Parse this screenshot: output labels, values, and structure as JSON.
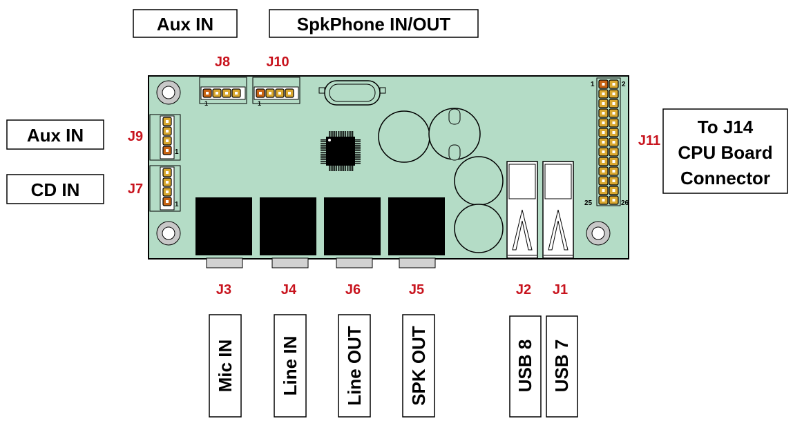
{
  "colors": {
    "board": "#b4dcc6",
    "outline": "#000000",
    "jack": "#000000",
    "connector_label": "#c8141e",
    "pin_gold": "#d9a830",
    "pin_first": "#c86414",
    "mount_hole_ring": "#c8c8c8"
  },
  "top_boxes": [
    {
      "text": "Aux IN"
    },
    {
      "text": "SpkPhone IN/OUT"
    }
  ],
  "left_boxes": [
    {
      "text": "Aux IN"
    },
    {
      "text": "CD IN"
    }
  ],
  "right_box": {
    "lines": [
      "To J14",
      "CPU Board",
      "Connector"
    ]
  },
  "connector_labels": {
    "J8": "J8",
    "J10": "J10",
    "J9": "J9",
    "J7": "J7",
    "J11": "J11",
    "J3": "J3",
    "J4": "J4",
    "J6": "J6",
    "J5": "J5",
    "J2": "J2",
    "J1": "J1"
  },
  "pin_numbers": {
    "j8_pin1": "1",
    "j10_pin1": "1",
    "j9_pin1": "1",
    "j7_pin1": "1",
    "j11_pin1": "1",
    "j11_pin2": "2",
    "j11_pin25": "25",
    "j11_pin26": "26"
  },
  "bottom_boxes": [
    {
      "text": "Mic IN"
    },
    {
      "text": "Line IN"
    },
    {
      "text": "Line OUT"
    },
    {
      "text": "SPK OUT"
    },
    {
      "text": "USB 8"
    },
    {
      "text": "USB 7"
    }
  ]
}
